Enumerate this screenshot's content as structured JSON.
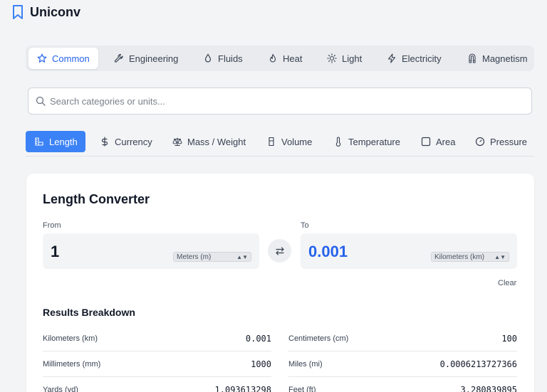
{
  "app": {
    "title": "Uniconv",
    "icon": "bookmark-icon"
  },
  "category_tabs": [
    {
      "label": "Common",
      "icon": "star-icon",
      "active": true
    },
    {
      "label": "Engineering",
      "icon": "wrench-icon",
      "active": false
    },
    {
      "label": "Fluids",
      "icon": "droplet-icon",
      "active": false
    },
    {
      "label": "Heat",
      "icon": "flame-icon",
      "active": false
    },
    {
      "label": "Light",
      "icon": "sun-icon",
      "active": false
    },
    {
      "label": "Electricity",
      "icon": "bolt-icon",
      "active": false
    },
    {
      "label": "Magnetism",
      "icon": "magnet-icon",
      "active": false
    }
  ],
  "search": {
    "placeholder": "Search categories or units...",
    "value": ""
  },
  "unit_tabs": [
    {
      "label": "Length",
      "icon": "ruler-icon",
      "active": true
    },
    {
      "label": "Currency",
      "icon": "dollar-icon",
      "active": false
    },
    {
      "label": "Mass / Weight",
      "icon": "scale-icon",
      "active": false
    },
    {
      "label": "Volume",
      "icon": "beaker-icon",
      "active": false
    },
    {
      "label": "Temperature",
      "icon": "thermometer-icon",
      "active": false
    },
    {
      "label": "Area",
      "icon": "square-icon",
      "active": false
    },
    {
      "label": "Pressure",
      "icon": "gauge-icon",
      "active": false
    }
  ],
  "converter": {
    "title": "Length Converter",
    "from_label": "From",
    "to_label": "To",
    "from_value": "1",
    "from_unit": "Meters (m)",
    "to_value": "0.001",
    "to_unit": "Kilometers (km)",
    "clear_label": "Clear",
    "swap_icon": "swap-icon"
  },
  "results": {
    "title": "Results Breakdown",
    "rows": [
      {
        "unit": "Kilometers (km)",
        "value": "0.001"
      },
      {
        "unit": "Centimeters (cm)",
        "value": "100"
      },
      {
        "unit": "Millimeters (mm)",
        "value": "1000"
      },
      {
        "unit": "Miles (mi)",
        "value": "0.0006213727366"
      },
      {
        "unit": "Yards (yd)",
        "value": "1.093613298"
      },
      {
        "unit": "Feet (ft)",
        "value": "3.280839895"
      }
    ]
  },
  "colors": {
    "accent": "#3b82f6",
    "accent_text": "#2563eb",
    "background": "#f3f4f6"
  }
}
